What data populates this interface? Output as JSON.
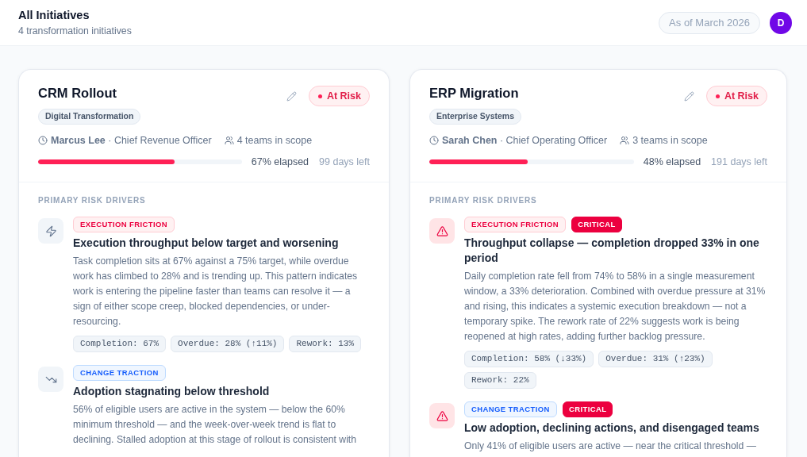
{
  "header": {
    "title": "All Initiatives",
    "subtitle": "4 transformation initiatives",
    "as_of": "As of March 2026",
    "avatar": "D"
  },
  "initiatives": [
    {
      "name": "CRM Rollout",
      "status": {
        "kind": "at_risk",
        "label": "At Risk"
      },
      "category": "Digital Transformation",
      "owner": "**Marcus Lee** · Chief Revenue Officer",
      "teams": "4 teams in scope",
      "elapsed": {
        "level": 0.67,
        "reading": "67% elapsed"
      },
      "days_left": "99 days left",
      "drivers_heading": "PRIMARY RISK DRIVERS",
      "drivers": [
        {
          "kind": "execution",
          "label": "EXECUTION FRICTION",
          "critical": false,
          "title": "Execution throughput below target and worsening",
          "description": "Task completion sits at 67% against a 75% target, while overdue work has climbed to 28% and is trending up. This pattern indicates work is entering the pipeline faster than teams can resolve it — a sign of either scope creep, blocked dependencies, or under-resourcing.",
          "metrics": [
            "Completion: 67%",
            "Overdue: 28% (↑11%)",
            "Rework: 13%"
          ]
        },
        {
          "kind": "adoption",
          "label": "CHANGE TRACTION",
          "critical": false,
          "title": "Adoption stagnating below threshold",
          "description": "56% of eligible users are active in the system — below the 60% minimum threshold — and the week-over-week trend is flat to declining. Stalled adoption at this stage of rollout is consistent with"
        }
      ]
    },
    {
      "name": "ERP Migration",
      "status": {
        "kind": "at_risk",
        "label": "At Risk"
      },
      "category": "Enterprise Systems",
      "owner": "**Sarah Chen** · Chief Operating Officer",
      "teams": "3 teams in scope",
      "elapsed": {
        "level": 0.48,
        "reading": "48% elapsed"
      },
      "days_left": "191 days left",
      "drivers_heading": "PRIMARY RISK DRIVERS",
      "drivers": [
        {
          "kind": "execution",
          "label": "EXECUTION FRICTION",
          "critical": true,
          "critical_label": "CRITICAL",
          "title": "Throughput collapse — completion dropped 33% in one period",
          "description": "Daily completion rate fell from 74% to 58% in a single measurement window, a 33% deterioration. Combined with overdue pressure at 31% and rising, this indicates a systemic execution breakdown — not a temporary spike. The rework rate of 22% suggests work is being reopened at high rates, adding further backlog pressure.",
          "metrics": [
            "Completion: 58% (↓33%)",
            "Overdue: 31% (↑23%)",
            "Rework: 22%"
          ]
        },
        {
          "kind": "adoption",
          "label": "CHANGE TRACTION",
          "critical": true,
          "critical_label": "CRITICAL",
          "title": "Low adoption, declining actions, and disengaged teams",
          "description": "Only 41% of eligible users are active — near the critical threshold —"
        }
      ]
    }
  ]
}
